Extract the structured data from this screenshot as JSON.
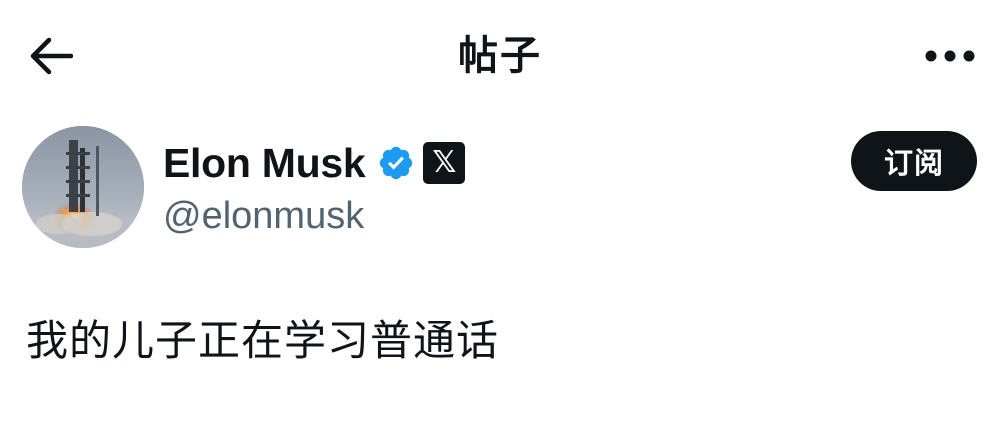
{
  "header": {
    "title": "帖子",
    "back_icon": "arrow-left-icon",
    "more_icon": "more-horizontal-icon"
  },
  "author": {
    "display_name": "Elon Musk",
    "handle": "@elonmusk",
    "verified_icon": "verified-badge-icon",
    "verified_color": "#1d9bf0",
    "affiliate_badge_label": "𝕏",
    "avatar_icon": "rocket-launch-avatar"
  },
  "subscribe_button": {
    "label": "订阅"
  },
  "post": {
    "text": "我的儿子正在学习普通话"
  },
  "colors": {
    "text_primary": "#0f1419",
    "text_secondary": "#536471",
    "background": "#ffffff",
    "button_bg": "#0f1419"
  }
}
